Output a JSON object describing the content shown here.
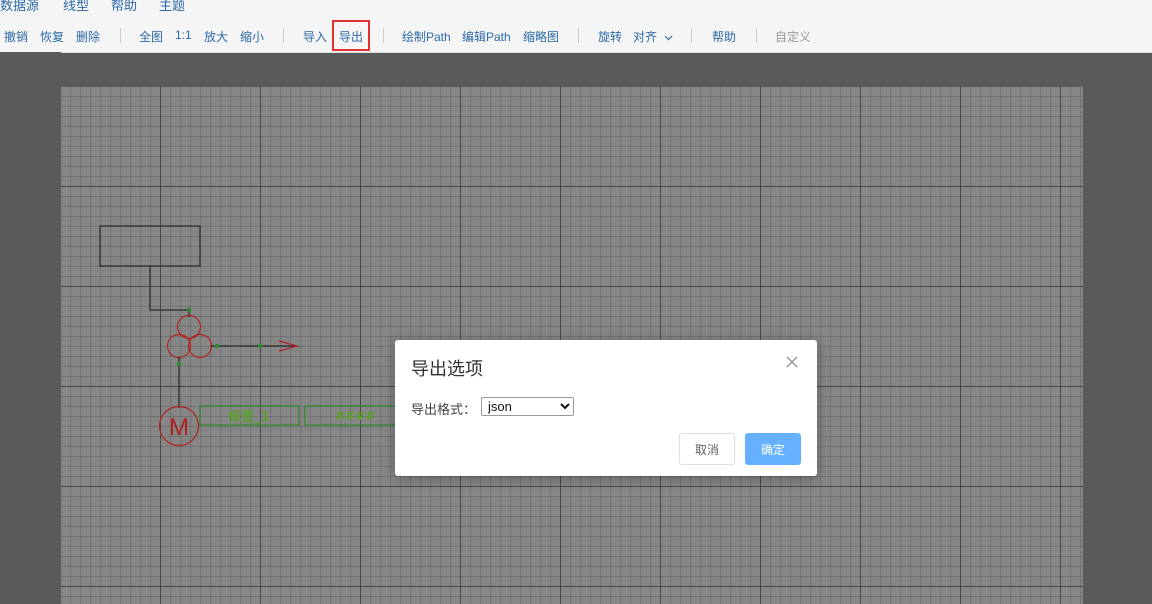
{
  "menubar": {
    "items": [
      "数据源",
      "线型",
      "帮助",
      "主题"
    ]
  },
  "toolbar": {
    "undo": "撤销",
    "redo": "恢复",
    "delete": "删除",
    "fit": "全图",
    "actual": "1:1",
    "zoom_in": "放大",
    "zoom_out": "缩小",
    "import": "导入",
    "export": "导出",
    "draw_path": "绘制Path",
    "edit_path": "编辑Path",
    "thumbnail": "缩略图",
    "rotate": "旋转",
    "align": "对齐",
    "help": "帮助",
    "custom": "自定义"
  },
  "diagram": {
    "motor_symbol": "M",
    "label_text": "标签_1",
    "value_text": "####"
  },
  "dialog": {
    "title": "导出选项",
    "format_label": "导出格式：",
    "format_value": "json",
    "cancel_label": "取消",
    "ok_label": "确定"
  },
  "colors": {
    "accent": "#2d6aa8",
    "highlight_box": "#e03030",
    "ok_button": "#66b1ff",
    "diagram_red": "#b22222",
    "diagram_green": "#2e8b2e"
  }
}
